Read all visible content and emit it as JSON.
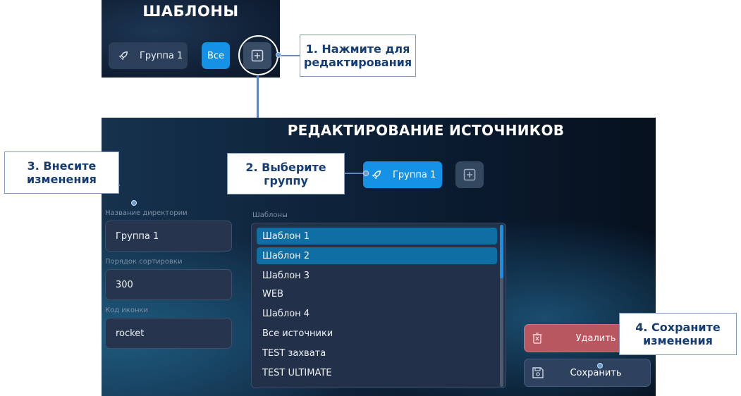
{
  "top_panel": {
    "title": "ШАБЛОНЫ",
    "group_chip": {
      "label": "Группа 1",
      "icon": "rocket-icon"
    },
    "all_chip": {
      "label": "Все"
    },
    "add_button": {
      "icon": "plus-square-icon"
    }
  },
  "callouts": {
    "step1": "1. Нажмите для редактирования",
    "step2": "2. Выберите группу",
    "step3": "3. Внесите изменения",
    "step4": "4. Сохраните изменения"
  },
  "main_panel": {
    "title": "РЕДАКТИРОВАНИЕ ИСТОЧНИКОВ",
    "group_chip": {
      "label": "Группа 1",
      "icon": "rocket-icon"
    },
    "add_button": {
      "icon": "plus-square-icon"
    },
    "fields": [
      {
        "label": "Название директории",
        "value": "Группа 1"
      },
      {
        "label": "Порядок сортировки",
        "value": "300"
      },
      {
        "label": "Код иконки",
        "value": "rocket"
      }
    ],
    "templates": {
      "label": "Шаблоны",
      "items": [
        {
          "label": "Шаблон 1",
          "selected": true
        },
        {
          "label": "Шаблон 2",
          "selected": true
        },
        {
          "label": "Шаблон 3",
          "selected": false
        },
        {
          "label": "WEB",
          "selected": false
        },
        {
          "label": "Шаблон 4",
          "selected": false
        },
        {
          "label": "Все источники",
          "selected": false
        },
        {
          "label": "TEST захвата",
          "selected": false
        },
        {
          "label": "TEST ULTIMATE",
          "selected": false
        }
      ]
    },
    "delete_button": {
      "label": "Удалить",
      "icon": "trash-icon"
    },
    "save_button": {
      "label": "Сохранить",
      "icon": "save-icon"
    }
  },
  "colors": {
    "accent": "#1592e6",
    "selected_item": "#0f6ea3",
    "delete": "#b8575f",
    "callout_text": "#163d73"
  }
}
